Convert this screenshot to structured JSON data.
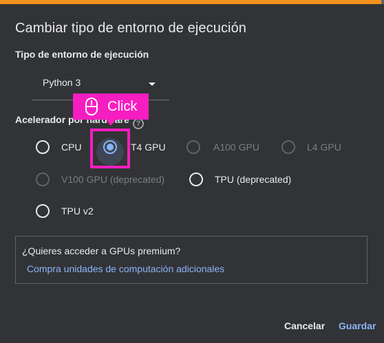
{
  "dialog": {
    "title": "Cambiar tipo de entorno de ejecución",
    "runtime_type": {
      "label": "Tipo de entorno de ejecución",
      "selected": "Python 3"
    },
    "accelerator": {
      "label": "Acelerador por hardware",
      "options": [
        {
          "label": "CPU",
          "state": "enabled"
        },
        {
          "label": "T4 GPU",
          "state": "checked"
        },
        {
          "label": "A100 GPU",
          "state": "disabled"
        },
        {
          "label": "L4 GPU",
          "state": "disabled"
        },
        {
          "label": "V100 GPU (deprecated)",
          "state": "disabled"
        },
        {
          "label": "TPU (deprecated)",
          "state": "enabled"
        },
        {
          "label": "TPU v2",
          "state": "enabled"
        }
      ]
    },
    "premium": {
      "question": "¿Quieres acceder a GPUs premium?",
      "link": "Compra unidades de computación adicionales"
    },
    "buttons": {
      "cancel": "Cancelar",
      "save": "Guardar"
    }
  },
  "annotation": {
    "text": "Click",
    "color": "#f71ec1"
  },
  "colors": {
    "accent": "#f6921e",
    "primary": "#8ab4f8",
    "background": "#323336"
  }
}
